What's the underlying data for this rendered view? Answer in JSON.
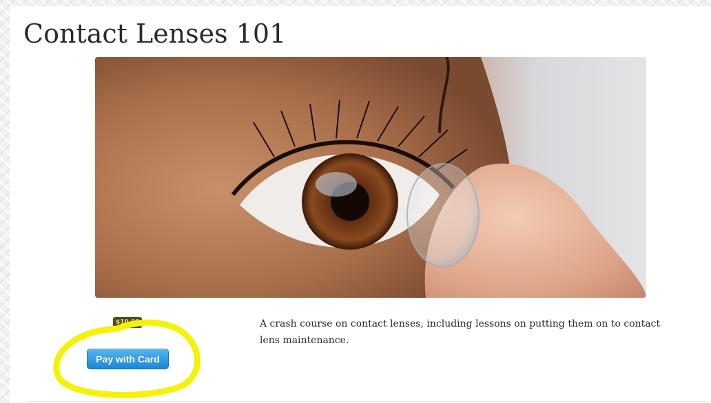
{
  "course": {
    "title": "Contact Lenses 101",
    "description": "A crash course on contact lenses, including lessons on putting them on to contact lens maintenance.",
    "price_badge": "$10.00",
    "pay_button_label": "Pay with Card"
  },
  "image": {
    "subject": "close-up of eye with contact lens on fingertip"
  },
  "colors": {
    "annotation_highlight": "#f5f20a",
    "pay_button": "#2a93dd",
    "price_badge_bg": "#4d4d1c",
    "price_badge_text": "#f1e56b"
  }
}
